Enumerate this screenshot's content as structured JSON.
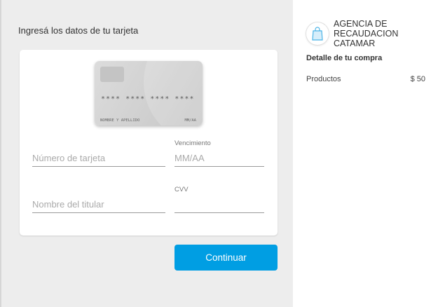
{
  "form": {
    "title": "Ingresá los datos de tu tarjeta",
    "card_preview": {
      "number": "**** **** **** ****",
      "name": "NOMBRE Y APELLIDO",
      "expiry": "MM/AA"
    },
    "card_number": {
      "placeholder": "Número de tarjeta"
    },
    "expiry": {
      "label": "Vencimiento",
      "placeholder": "MM/AA"
    },
    "holder_name": {
      "placeholder": "Nombre del titular"
    },
    "cvv": {
      "label": "CVV",
      "value": ""
    },
    "continue_label": "Continuar"
  },
  "summary": {
    "merchant": "AGENCIA DE RECAUDACION CATAMAR",
    "logo_icon": "shopping-bag-icon",
    "detail_title": "Detalle de tu compra",
    "items": [
      {
        "label": "Productos",
        "price": "$ 50"
      }
    ]
  },
  "colors": {
    "accent": "#009ee3",
    "sidebar_bg": "#ffffff",
    "page_bg": "#ededed"
  }
}
